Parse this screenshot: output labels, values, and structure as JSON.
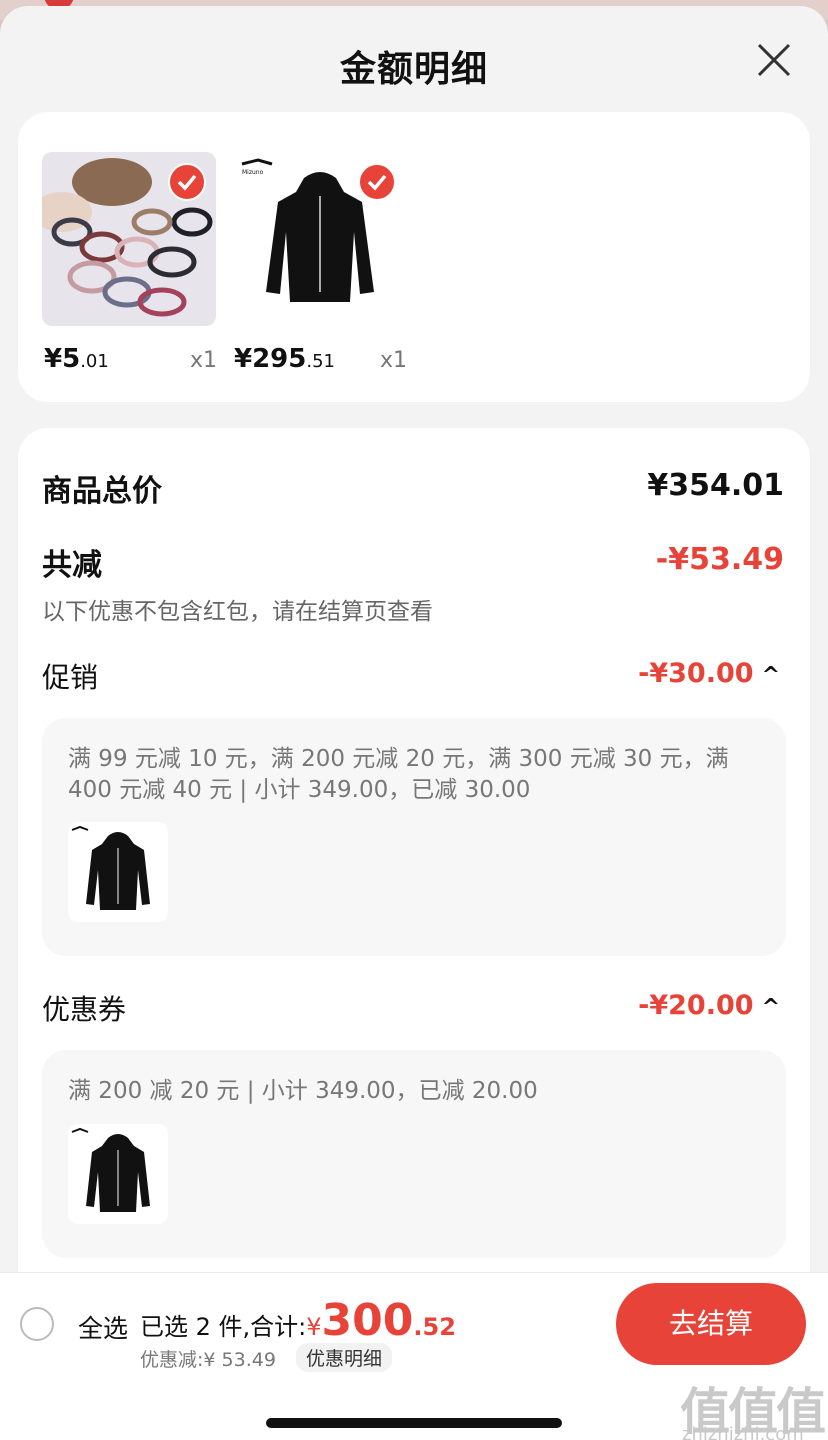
{
  "sheet": {
    "title": "金额明细"
  },
  "products": [
    {
      "price_int": "¥5",
      "price_dec": ".01",
      "qty": "x1",
      "image": "hair-ties-photo"
    },
    {
      "price_int": "¥295",
      "price_dec": ".51",
      "qty": "x1",
      "image": "black-jacket-photo"
    }
  ],
  "summary": {
    "total_label": "商品总价",
    "total_value": "¥354.01",
    "discount_label": "共减",
    "discount_value": "-¥53.49",
    "discount_note": "以下优惠不包含红包，请在结算页查看"
  },
  "promotion": {
    "label": "促销",
    "value": "-¥30.00",
    "chevron": "^",
    "detail_line1": "满 99 元减 10 元，满 200 元减 20 元，满 300 元减 30 元，满",
    "detail_line2": "400 元减 40 元 | 小计 349.00，已减 30.00"
  },
  "coupon": {
    "label": "优惠券",
    "value": "-¥20.00",
    "chevron": "^",
    "detail": "满 200 减 20 元 | 小计 349.00，已减 20.00"
  },
  "bottom_bar": {
    "select_all": "全选",
    "selected_prefix": "已选 2 件,合计:",
    "currency": "¥",
    "total_int": "300",
    "total_dec": ".52",
    "discount_text": "优惠减:¥ 53.49",
    "detail_tag": "优惠明细",
    "checkout": "去结算"
  },
  "watermark": {
    "logo": "值值值",
    "site": "zhizhizhi.com"
  },
  "colors": {
    "accent": "#e84338",
    "text": "#111111",
    "muted": "#777777",
    "panel": "#f7f7f7"
  }
}
